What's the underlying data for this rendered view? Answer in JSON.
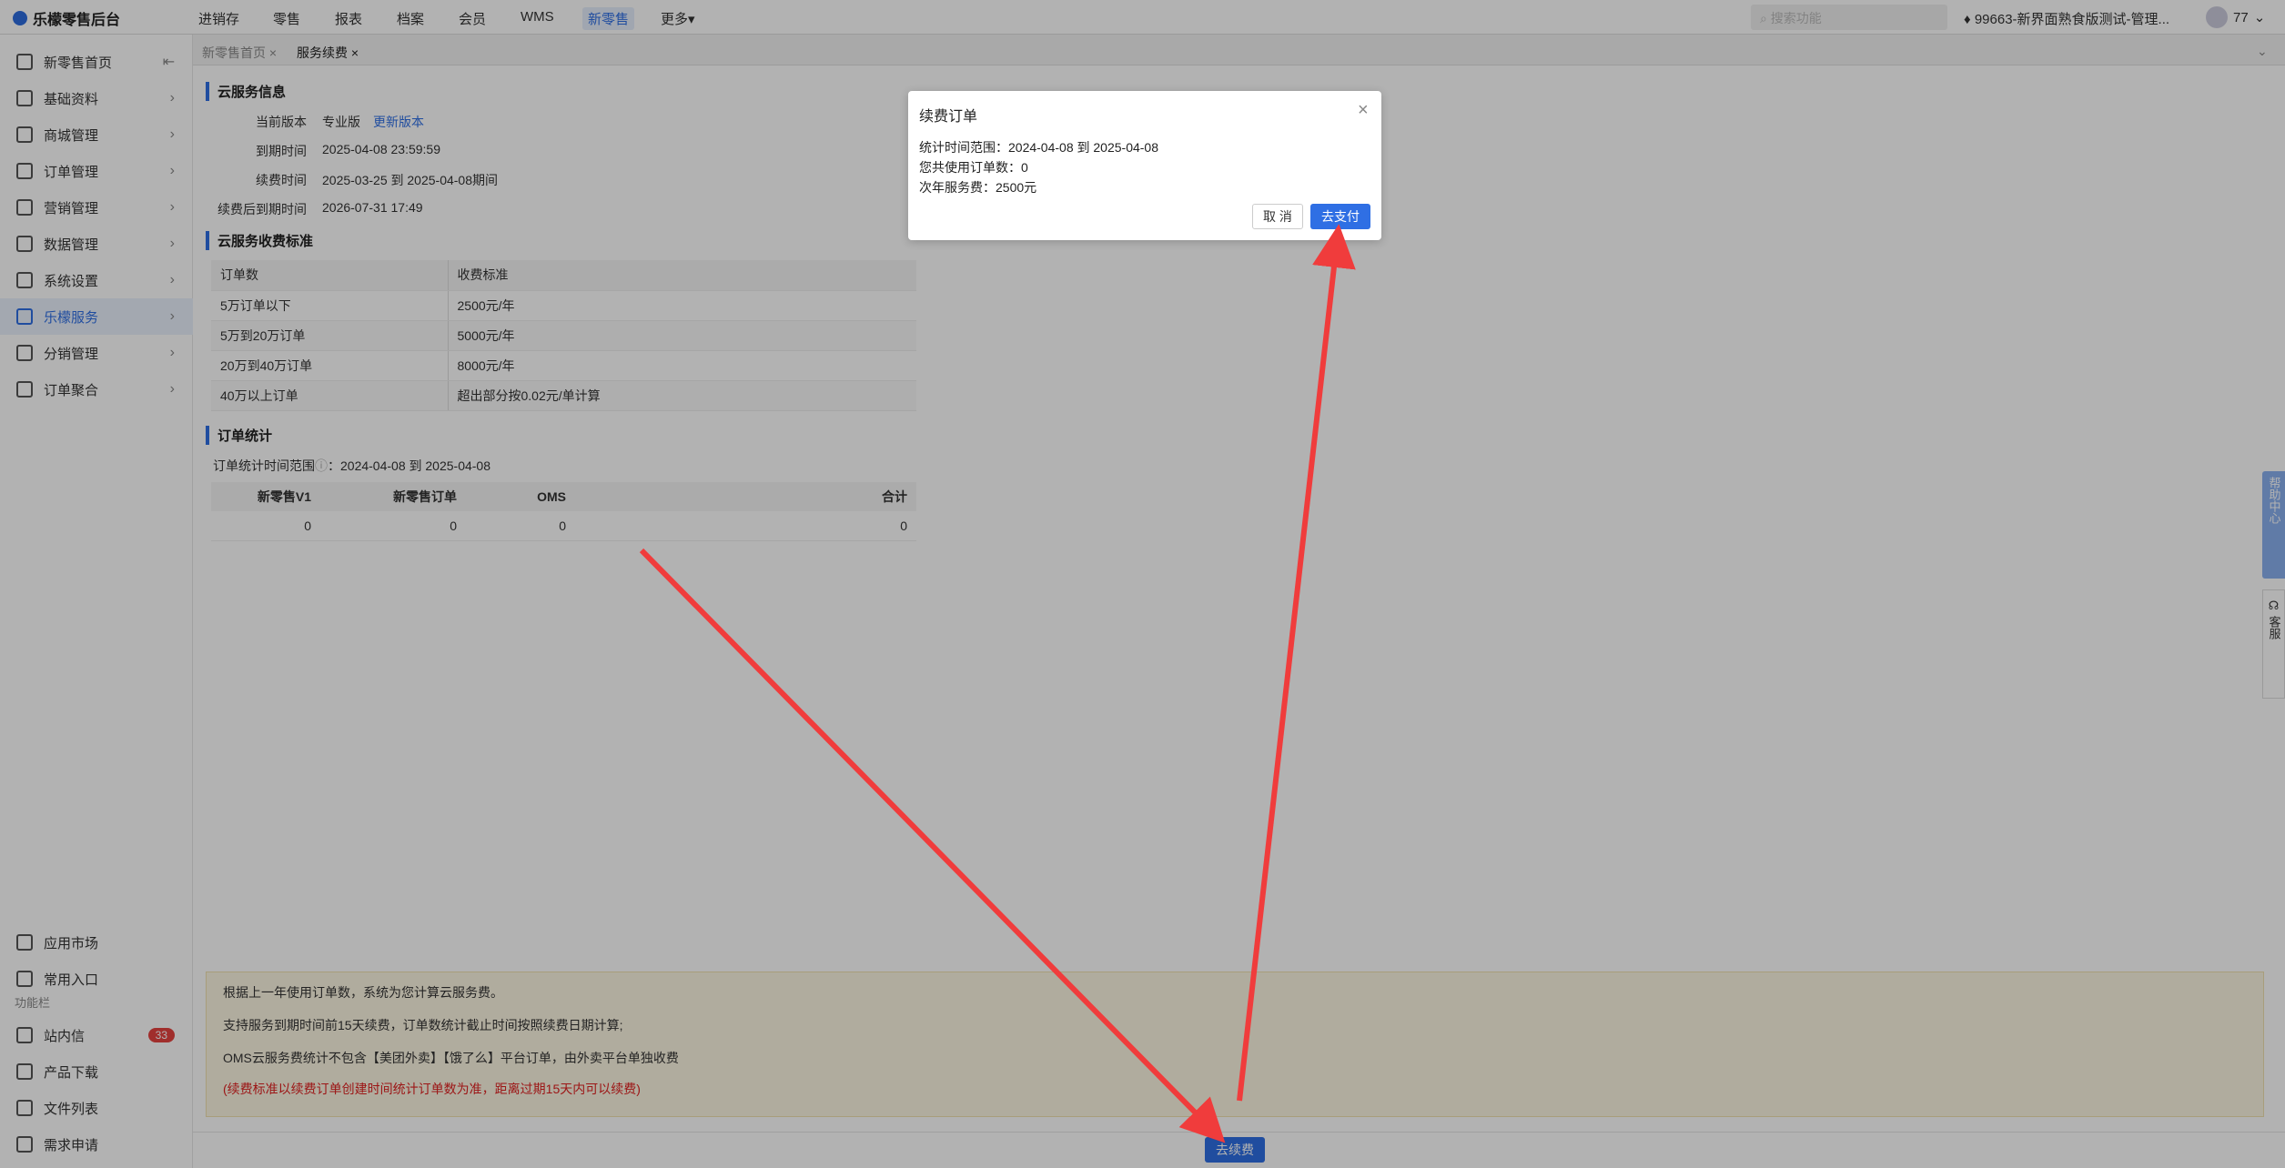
{
  "app": {
    "logo_text": "乐檬零售后台"
  },
  "topnav": {
    "items": [
      "进销存",
      "零售",
      "报表",
      "档案",
      "会员",
      "WMS",
      "新零售",
      "更多▾"
    ],
    "active": "新零售",
    "search_placeholder": "搜索功能",
    "tenant": "99663-新界面熟食版测试-管理...",
    "user": "77"
  },
  "sidebar": {
    "items": [
      {
        "label": "新零售首页",
        "icon": "home-icon"
      },
      {
        "label": "基础资料",
        "icon": "grid-icon"
      },
      {
        "label": "商城管理",
        "icon": "store-icon"
      },
      {
        "label": "订单管理",
        "icon": "order-icon"
      },
      {
        "label": "营销管理",
        "icon": "marketing-icon"
      },
      {
        "label": "数据管理",
        "icon": "chart-icon"
      },
      {
        "label": "系统设置",
        "icon": "gear-icon"
      },
      {
        "label": "乐檬服务",
        "icon": "service-icon"
      },
      {
        "label": "分销管理",
        "icon": "distribution-icon"
      },
      {
        "label": "订单聚合",
        "icon": "aggregate-icon"
      }
    ],
    "bottom_items": [
      {
        "label": "应用市场"
      },
      {
        "label": "常用入口"
      }
    ],
    "section_label": "功能栏",
    "func_items": [
      {
        "label": "站内信",
        "badge": "33"
      },
      {
        "label": "产品下载"
      },
      {
        "label": "文件列表"
      },
      {
        "label": "需求申请"
      }
    ]
  },
  "tabs": [
    "新零售首页 ×",
    "服务续费 ×"
  ],
  "cloud_info": {
    "title": "云服务信息",
    "rows": [
      {
        "label": "当前版本",
        "value": "专业版",
        "link": "更新版本"
      },
      {
        "label": "到期时间",
        "value": "2025-04-08 23:59:59"
      },
      {
        "label": "续费时间",
        "value": "2025-03-25 到 2025-04-08期间"
      },
      {
        "label": "续费后到期时间",
        "value": "2026-07-31 17:49"
      }
    ]
  },
  "fee_standard": {
    "title": "云服务收费标准",
    "headers": [
      "订单数",
      "收费标准"
    ],
    "rows": [
      [
        "5万订单以下",
        "2500元/年"
      ],
      [
        "5万到20万订单",
        "5000元/年"
      ],
      [
        "20万到40万订单",
        "8000元/年"
      ],
      [
        "40万以上订单",
        "超出部分按0.02元/单计算"
      ]
    ]
  },
  "order_stats": {
    "title": "订单统计",
    "range_label": "订单统计时间范围",
    "range_value": "：2024-04-08 到 2025-04-08",
    "headers": [
      "新零售V1",
      "新零售订单",
      "OMS",
      "合计"
    ],
    "row": [
      "0",
      "0",
      "0",
      "0"
    ]
  },
  "notice": {
    "lines": [
      "根据上一年使用订单数，系统为您计算云服务费。",
      "支持服务到期时间前15天续费，订单数统计截止时间按照续费日期计算;",
      "OMS云服务费统计不包含【美团外卖】【饿了么】平台订单，由外卖平台单独收费"
    ],
    "red_line": "(续费标准以续费订单创建时间统计订单数为准，距离过期15天内可以续费)"
  },
  "renew_button": "去续费",
  "float": {
    "help": "帮助中心",
    "service": "客服"
  },
  "modal": {
    "title": "续费订单",
    "lines": [
      "统计时间范围：2024-04-08 到 2025-04-08",
      "您共使用订单数：0",
      "次年服务费：2500元"
    ],
    "cancel": "取 消",
    "pay": "去支付"
  },
  "colors": {
    "accent": "#2f6fe4",
    "arrow": "#f03c3c",
    "badge": "#e64340"
  }
}
